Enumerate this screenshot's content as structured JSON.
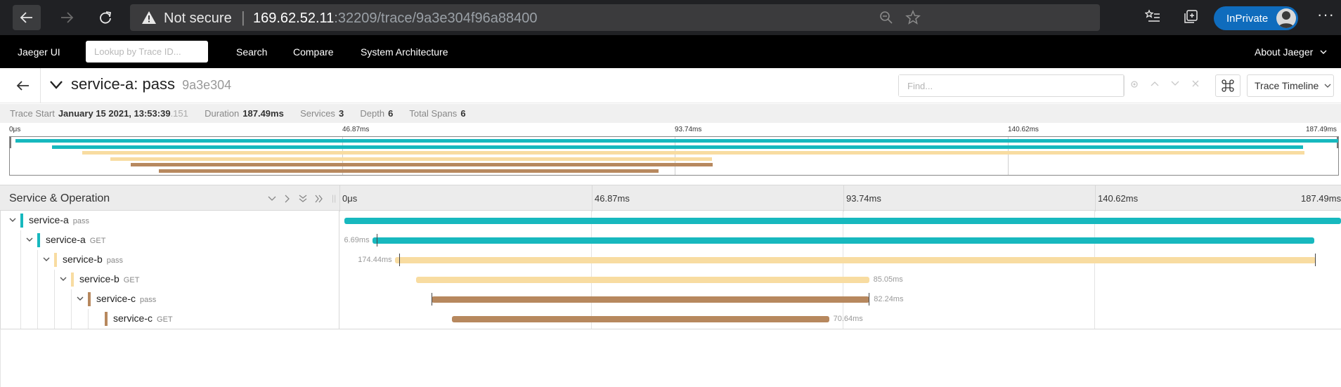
{
  "browser": {
    "security_label": "Not secure",
    "url_host": "169.62.52.11",
    "url_rest": ":32209/trace/9a3e304f96a88400",
    "inprivate_label": "InPrivate",
    "more_label": "···"
  },
  "nav": {
    "brand": "Jaeger UI",
    "lookup_placeholder": "Lookup by Trace ID...",
    "search": "Search",
    "compare": "Compare",
    "system_architecture": "System Architecture",
    "about": "About Jaeger"
  },
  "trace": {
    "service": "service-a: pass",
    "trace_id_short": "9a3e304",
    "find_placeholder": "Find...",
    "view_mode": "Trace Timeline"
  },
  "info": {
    "trace_start_label": "Trace Start",
    "trace_start_value": "January 15 2021, 13:53:39",
    "trace_start_fraction": ".151",
    "duration_label": "Duration",
    "duration_value": "187.49ms",
    "services_label": "Services",
    "services_value": "3",
    "depth_label": "Depth",
    "depth_value": "6",
    "total_spans_label": "Total Spans",
    "total_spans_value": "6"
  },
  "ticks": [
    "0μs",
    "46.87ms",
    "93.74ms",
    "140.62ms",
    "187.49ms"
  ],
  "timeline": {
    "column_title": "Service & Operation"
  },
  "colors": {
    "service-a": "#17b8be",
    "service-b": "#f8dca1",
    "service-c": "#b7885e"
  },
  "spans": [
    {
      "service": "service-a",
      "operation": "pass",
      "depth": 0,
      "start": 0.004,
      "end": 1.0,
      "label": ""
    },
    {
      "service": "service-a",
      "operation": "GET",
      "depth": 1,
      "start": 0.032,
      "end": 0.9735,
      "label": "6.69ms"
    },
    {
      "service": "service-b",
      "operation": "pass",
      "depth": 2,
      "start": 0.0545,
      "end": 0.9745,
      "label": "174.44ms"
    },
    {
      "service": "service-b",
      "operation": "GET",
      "depth": 3,
      "start": 0.0755,
      "end": 0.5285,
      "label": "85.05ms"
    },
    {
      "service": "service-c",
      "operation": "pass",
      "depth": 4,
      "start": 0.091,
      "end": 0.529,
      "label": "82.24ms"
    },
    {
      "service": "service-c",
      "operation": "GET",
      "depth": 5,
      "start": 0.112,
      "end": 0.4885,
      "label": "70.64ms"
    }
  ]
}
